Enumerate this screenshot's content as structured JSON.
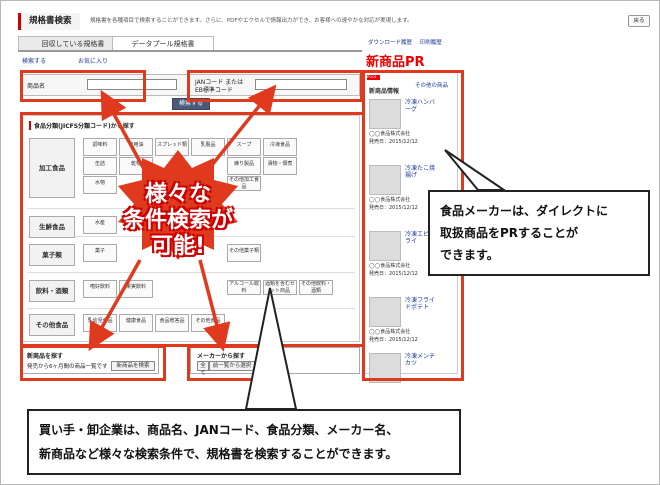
{
  "header": {
    "title": "規格書検索",
    "description": "規格書を各種項目で検索することができます。さらに、PDFやエクセルで情報出力ができ、お客様への速やかな対応が実現します。",
    "back_label": "戻る"
  },
  "tabs": [
    {
      "label": "回収している規格書"
    },
    {
      "label": "データプール規格書"
    }
  ],
  "toplinks": {
    "download": "ダウンロード履歴",
    "print": "印刷履歴"
  },
  "shin_pr": "新商品PR",
  "subnav": {
    "search": "検索する",
    "favorites": "お気に入り"
  },
  "search_fields": {
    "product_name_label": "商品名",
    "jan_label_1": "JANコード または",
    "jan_label_2": "EB標準コード",
    "search_button": "検索する"
  },
  "category": {
    "title": "食品分類(JICFS分類コード)から探す",
    "groups": [
      {
        "name": "加工食品",
        "items": [
          "調味料",
          "食用油",
          "スプレッド類",
          "乳製品",
          "スープ",
          "冷凍食品",
          "缶詰",
          "乾物",
          "",
          "",
          "練り製品",
          "漬物・佃煮",
          "水物",
          "",
          "",
          "",
          "その他加工食品"
        ]
      },
      {
        "name": "生鮮食品",
        "items": [
          "水産"
        ]
      },
      {
        "name": "菓子類",
        "items": [
          "菓子",
          "",
          "",
          "",
          "その他菓子類"
        ]
      },
      {
        "name": "飲料・酒類",
        "items": [
          "嗜好飲料",
          "果実飲料",
          "",
          "",
          "アルコール飲料",
          "酒類を含むセット商品",
          "その他飲料・酒類"
        ]
      },
      {
        "name": "その他食品",
        "items": [
          "乳幼児食品",
          "健康食品",
          "食品贈答品",
          "その他食品"
        ]
      }
    ]
  },
  "new_products": {
    "title": "新商品を探す",
    "text": "発売から6ヶ月間の商品一覧です",
    "button": "新商品を検索"
  },
  "maker": {
    "title": "メーカーから探す",
    "all_label": "全て",
    "button": "前一覧から選択"
  },
  "side": {
    "badge": "POOL",
    "title": "新商品情報",
    "more_link": "その他の商品",
    "products": [
      {
        "name": "冷凍ハンバーグ",
        "company": "◯◯食品株式会社",
        "date": "発売日：2015/12/12"
      },
      {
        "name": "冷凍たこ焼揚げ",
        "company": "◯◯食品株式会社",
        "date": "発売日：2015/12/12"
      },
      {
        "name": "冷凍エビフライ",
        "company": "◯◯食品株式会社",
        "date": "発売日：2015/12/12"
      },
      {
        "name": "冷凍フライドポテト",
        "company": "◯◯食品株式会社",
        "date": "発売日：2015/12/12"
      },
      {
        "name": "冷凍メンチカツ",
        "company": "",
        "date": ""
      }
    ]
  },
  "burst": {
    "line1": "様々な",
    "line2": "条件検索が",
    "line3": "可能!"
  },
  "callout_right": {
    "line1": "食品メーカーは、ダイレクトに",
    "line2": "取扱商品をPRすることが",
    "line3": "できます。"
  },
  "callout_bottom": {
    "line1": "買い手・卸企業は、商品名、JANコード、食品分類、メーカー名、",
    "line2": "新商品など様々な検索条件で、規格書を検索することができます。"
  },
  "colors": {
    "accent": "#e03a1e",
    "link": "#1a3d9c"
  }
}
